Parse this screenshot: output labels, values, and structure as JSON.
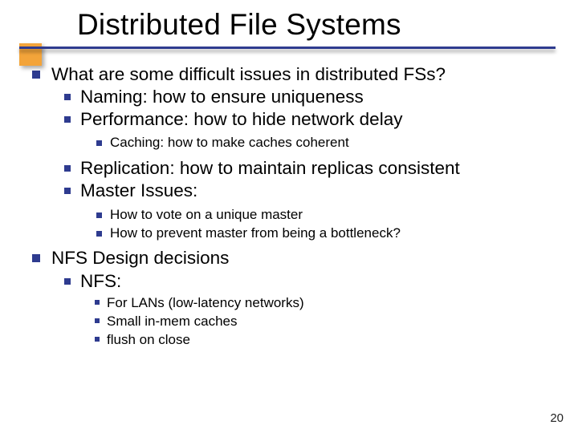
{
  "colors": {
    "accent_blue": "#2e3b8f",
    "accent_orange": "#f3a43a"
  },
  "title": "Distributed File Systems",
  "page_number": "20",
  "bullets": [
    {
      "text": "What are some difficult issues in distributed FSs?",
      "children": [
        {
          "text": "Naming: how to ensure uniqueness"
        },
        {
          "text": "Performance: how to hide network delay",
          "children": [
            {
              "text": "Caching: how to make caches coherent"
            }
          ]
        },
        {
          "text": "Replication: how to maintain replicas consistent"
        },
        {
          "text": "Master Issues:",
          "children": [
            {
              "text": "How to vote on a unique master"
            },
            {
              "text": "How to prevent master from being a bottleneck?"
            }
          ]
        }
      ]
    },
    {
      "text": "NFS Design decisions",
      "children": [
        {
          "text": "NFS:",
          "children": [
            {
              "text": "For LANs (low-latency networks)"
            },
            {
              "text": "Small in-mem caches"
            },
            {
              "text": "flush on close"
            }
          ]
        }
      ]
    }
  ]
}
